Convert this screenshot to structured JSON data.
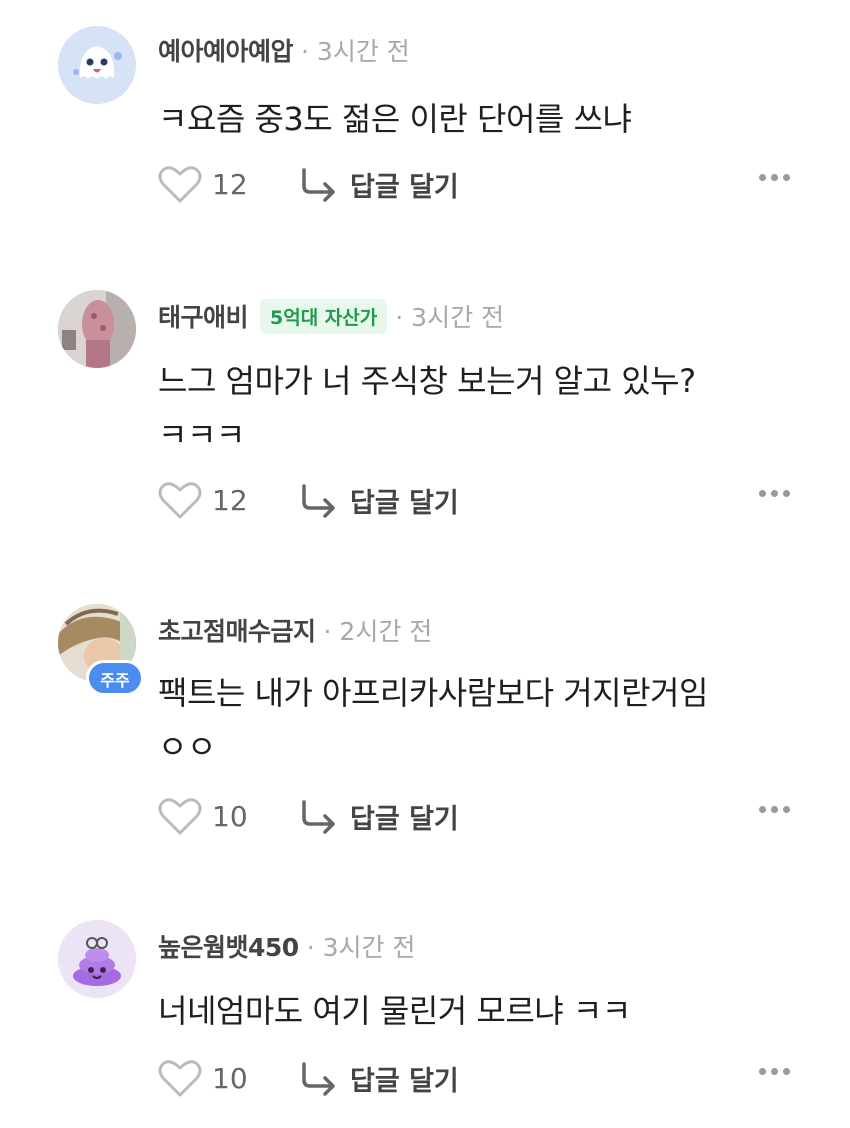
{
  "comments": [
    {
      "nickname": "예아예아예압",
      "time": "· 3시간 전",
      "tag": "",
      "lines": [
        "ㅋ요즘 중3도 젊은 이란 단어를 쓰냐"
      ],
      "likes": "12",
      "reply_label": "답글 달기",
      "avatar": "ghost-avatar"
    },
    {
      "nickname": "태구애비",
      "time": "· 3시간 전",
      "tag": "5억대 자산가",
      "lines": [
        "느그 엄마가 너 주식창 보는거 알고 있누?",
        "ㅋㅋㅋ"
      ],
      "likes": "12",
      "reply_label": "답글 달기",
      "avatar": "photo-avatar"
    },
    {
      "nickname": "초고점매수금지",
      "time": "· 2시간 전",
      "tag": "",
      "badge": "주주",
      "lines": [
        "팩트는 내가 아프리카사람보다 거지란거임",
        "ㅇㅇ"
      ],
      "likes": "10",
      "reply_label": "답글 달기",
      "avatar": "photo-avatar"
    },
    {
      "nickname": "높은웜뱃450",
      "time": "· 3시간 전",
      "tag": "",
      "lines": [
        "너네엄마도 여기 물린거 모르냐 ㅋㅋ"
      ],
      "likes": "10",
      "reply_label": "답글 달기",
      "avatar": "poop-avatar"
    }
  ],
  "colors": {
    "accent_green": "#1f9a4a",
    "badge_blue": "#4a8cf0"
  }
}
